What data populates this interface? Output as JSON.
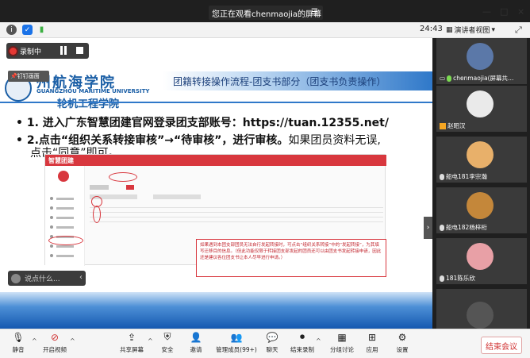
{
  "banner": {
    "text": "您正在观看chenmaojia的屏幕",
    "menu_icon": "menu-icon"
  },
  "window_controls": {
    "minimize": "—",
    "maximize": "□",
    "close": "×"
  },
  "toolbar": {
    "timer": "24:43",
    "view_label": "演讲者视图",
    "view_arrow": "▾"
  },
  "recording": {
    "label": "录制中"
  },
  "pin": {
    "label": "钉钉画面"
  },
  "slide": {
    "school_name": "州航海学院",
    "school_en": "GUANGZHOU MARITIME UNIVERSITY",
    "college": "轮机工程学院",
    "title": "团籍转接操作流程-团支书部分（团支书负责操作）",
    "bullet1": "• 1. 进入广东智慧团建官网登录团支部账号：https://tuan.12355.net/",
    "bullet2_bold": "• 2.点击“组织关系转接审核”→“待审核”，进行审核。",
    "bullet2_normal": "如果团员资料无误,",
    "bullet3": "点击“同意”即可。"
  },
  "webpage": {
    "brand": "智慧团建",
    "note": "如果遇到本团支部团员无法自行发起转接时，可点击“组织关系转接”中的“发起转接”，为其填写迁移目的信息。（但此功能仅限于转接团支部发起的团员还可以由团支书发起转接申请，因此还是建议各位团支书让本人尽早进行申请。）"
  },
  "chat": {
    "placeholder": "说点什么...",
    "arrow": "‹"
  },
  "participants": [
    {
      "name": "chenmaojia(屏幕共…",
      "mic": "hot"
    },
    {
      "name": "赵昭汉",
      "mic": "none"
    },
    {
      "name": "船电181李宗瀚",
      "mic": "normal"
    },
    {
      "name": "船电182杨梓桁",
      "mic": "normal"
    },
    {
      "name": "181陈乐欣",
      "mic": "normal"
    },
    {
      "name": "",
      "mic": "none"
    }
  ],
  "bottom_bar": {
    "mute": "静音",
    "video": "开启视频",
    "share": "共享屏幕",
    "security": "安全",
    "invite": "邀请",
    "participants": "管理成员(99+)",
    "chat": "聊天",
    "record": "结束录制",
    "breakout": "分组讨论",
    "apps": "应用",
    "settings": "设置",
    "end": "结束会议"
  },
  "colors": {
    "accent_red": "#d8373e",
    "slide_blue": "#1b5fa6",
    "recording_red": "#e53935",
    "mic_active": "#7cdb52"
  }
}
